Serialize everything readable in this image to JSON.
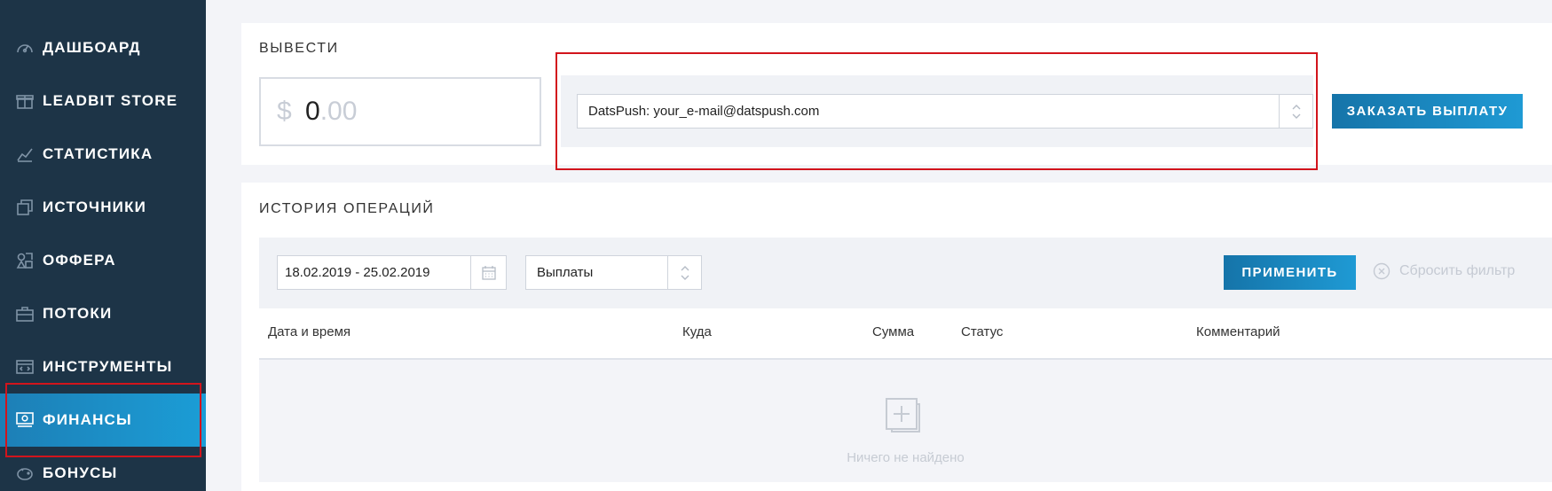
{
  "sidebar": {
    "items": [
      {
        "label": "ДАШБОАРД",
        "icon": "dashboard-gauge-icon"
      },
      {
        "label": "LEADBIT STORE",
        "icon": "store-gift-icon"
      },
      {
        "label": "СТАТИСТИКА",
        "icon": "chart-line-icon"
      },
      {
        "label": "ИСТОЧНИКИ",
        "icon": "layers-copy-icon"
      },
      {
        "label": "ОФФЕРА",
        "icon": "offers-shapes-icon"
      },
      {
        "label": "ПОТОКИ",
        "icon": "briefcase-icon"
      },
      {
        "label": "ИНСТРУМЕНТЫ",
        "icon": "code-window-icon"
      },
      {
        "label": "ФИНАНСЫ",
        "icon": "money-bill-icon",
        "active": true
      },
      {
        "label": "БОНУСЫ",
        "icon": "piggy-bank-icon"
      }
    ]
  },
  "withdraw": {
    "title": "ВЫВЕСТИ",
    "currency": "$",
    "amount_int": "0",
    "amount_dec": ".00",
    "method": "DatsPush: your_e-mail@datspush.com",
    "button": "ЗАКАЗАТЬ ВЫПЛАТУ"
  },
  "history": {
    "title": "ИСТОРИЯ ОПЕРАЦИЙ",
    "date_range": "18.02.2019 - 25.02.2019",
    "type": "Выплаты",
    "apply": "ПРИМЕНИТЬ",
    "reset": "Сбросить фильтр",
    "columns": [
      "Дата и время",
      "Куда",
      "Сумма",
      "Статус",
      "Комментарий"
    ],
    "empty": "Ничего не найдено"
  },
  "colors": {
    "sidebar_bg": "#1d3447",
    "accent": "#1b9dd6",
    "highlight": "#d2141c"
  }
}
